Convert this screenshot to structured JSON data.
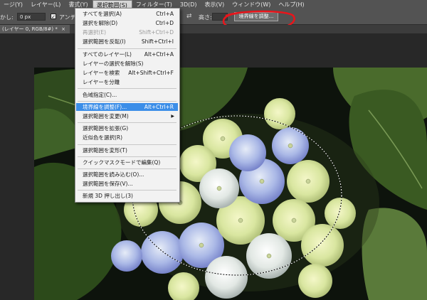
{
  "menubar": {
    "items": [
      {
        "label": "ージ(Y)"
      },
      {
        "label": "レイヤー(L)"
      },
      {
        "label": "書式(Y)"
      },
      {
        "label": "選択範囲(S)",
        "active": true
      },
      {
        "label": "フィルター(T)"
      },
      {
        "label": "3D(D)"
      },
      {
        "label": "表示(V)"
      },
      {
        "label": "ウィンドウ(W)"
      },
      {
        "label": "ヘルプ(H)"
      }
    ]
  },
  "options_bar": {
    "feather_label": "かし:",
    "feather_value": "0 px",
    "antialias_label": "アンチエイリ",
    "height_label": "高さ:",
    "refine_edge_button": "境界線を調整..."
  },
  "document_tab": {
    "label": "(レイヤー 0, RGB/8#) *",
    "close": "×"
  },
  "dropdown": {
    "items": [
      {
        "label": "すべてを選択(A)",
        "shortcut": "Ctrl+A"
      },
      {
        "label": "選択を解除(D)",
        "shortcut": "Ctrl+D"
      },
      {
        "label": "再選択(E)",
        "shortcut": "Shift+Ctrl+D",
        "disabled": true
      },
      {
        "label": "選択範囲を反転(I)",
        "shortcut": "Shift+Ctrl+I"
      },
      {
        "label": "すべてのレイヤー(L)",
        "shortcut": "Alt+Ctrl+A"
      },
      {
        "label": "レイヤーの選択を解除(S)",
        "shortcut": ""
      },
      {
        "label": "レイヤーを検索",
        "shortcut": "Alt+Shift+Ctrl+F"
      },
      {
        "label": "レイヤーを分離",
        "shortcut": ""
      },
      {
        "label": "色域指定(C)...",
        "shortcut": ""
      },
      {
        "label": "境界線を調整(F)...",
        "shortcut": "Alt+Ctrl+R",
        "highlighted": true
      },
      {
        "label": "選択範囲を変更(M)",
        "shortcut": "",
        "submenu": true
      },
      {
        "label": "選択範囲を拡張(G)",
        "shortcut": ""
      },
      {
        "label": "近似色を選択(R)",
        "shortcut": ""
      },
      {
        "label": "選択範囲を変形(T)",
        "shortcut": ""
      },
      {
        "label": "クイックマスクモードで編集(Q)",
        "shortcut": ""
      },
      {
        "label": "選択範囲を読み込む(O)...",
        "shortcut": ""
      },
      {
        "label": "選択範囲を保存(V)...",
        "shortcut": ""
      },
      {
        "label": "新規 3D 押し出し(3)",
        "shortcut": ""
      }
    ]
  },
  "colors": {
    "highlight": "#3c8ee8",
    "annotation_circle": "#e8151b",
    "ui_panel": "#535353"
  }
}
